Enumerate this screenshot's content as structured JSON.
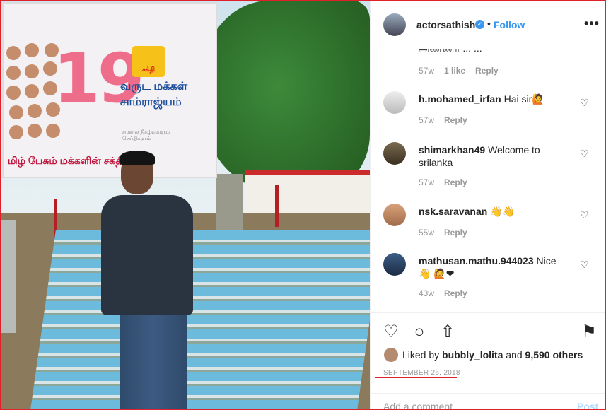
{
  "post": {
    "username": "actorsathish",
    "verified_mark": "✓",
    "separator": "•",
    "follow_label": "Follow",
    "more_label": "•••"
  },
  "photo": {
    "billboard_number": "19",
    "billboard_logo_text": "சக்தி",
    "billboard_line1": "வருட மக்கள்",
    "billboard_line2": "சாம்ராஜ்யம்",
    "billboard_small": "சமகால நிகழ்வுகளும் செய்திகளும்",
    "billboard_bottom": "மிழ் பேசும் மக்களின் சக்தி"
  },
  "comments": {
    "partial_text": "அண்ணா ... ...",
    "partial_meta": {
      "time": "57w",
      "likes": "1 like",
      "reply": "Reply"
    },
    "items": [
      {
        "user": "h.mohamed_irfan",
        "text": "Hai sir🙋",
        "time": "57w",
        "reply": "Reply"
      },
      {
        "user": "shimarkhan49",
        "text": "Welcome to srilanka",
        "time": "57w",
        "reply": "Reply"
      },
      {
        "user": "nsk.saravanan",
        "text": "👋👋",
        "time": "55w",
        "reply": "Reply"
      },
      {
        "user": "mathusan.mathu.944023",
        "text": "Nice 👋 🙋❤",
        "time": "43w",
        "reply": "Reply"
      }
    ]
  },
  "actions": {
    "liked_prefix": "Liked by",
    "liked_user": "bubbly_lolita",
    "liked_and": "and",
    "liked_count": "9,590 others",
    "date": "SEPTEMBER 26, 2018",
    "add_comment_placeholder": "Add a comment...",
    "post_label": "Post"
  },
  "colors": {
    "accent": "#3897f0",
    "highlight_border": "#e0202a"
  }
}
